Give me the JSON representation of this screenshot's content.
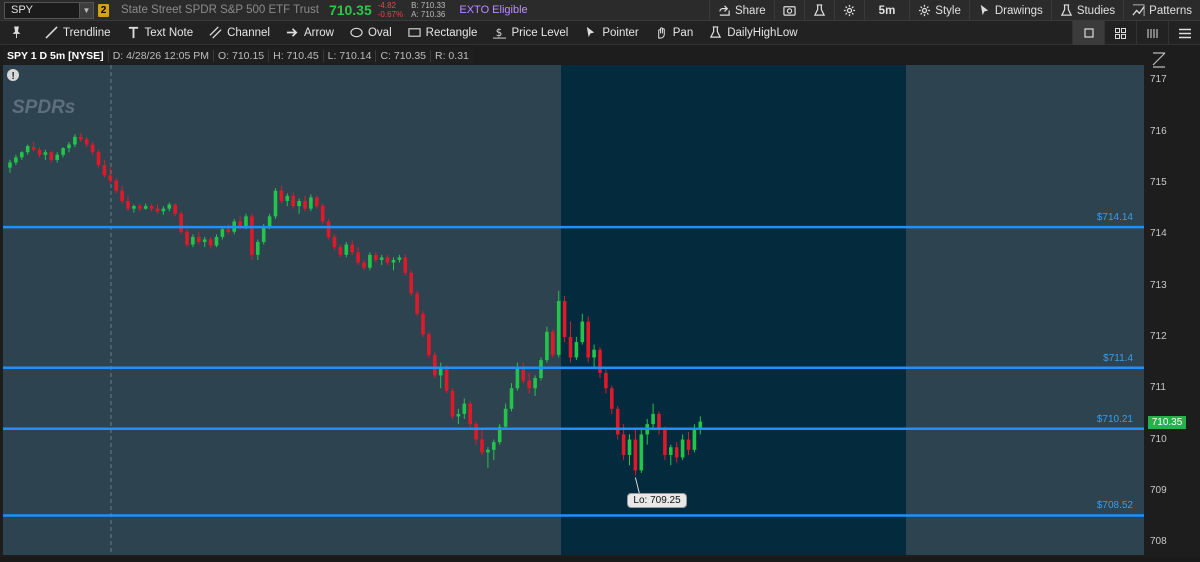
{
  "header": {
    "symbol": "SPY",
    "link_group": "2",
    "description": "State Street SPDR S&P 500 ETF Trust",
    "last": "710.35",
    "change": "-4.82",
    "change_pct": "-0.67%",
    "bid": "B: 710.33",
    "ask": "A: 710.36",
    "exto": "EXTO Eligible",
    "share_label": "Share",
    "timeframe": "5m",
    "style_label": "Style",
    "drawings_label": "Drawings",
    "studies_label": "Studies",
    "patterns_label": "Patterns"
  },
  "toolbar": {
    "trendline": "Trendline",
    "text_note": "Text Note",
    "channel": "Channel",
    "arrow": "Arrow",
    "oval": "Oval",
    "rectangle": "Rectangle",
    "price_level": "Price Level",
    "pointer": "Pointer",
    "pan": "Pan",
    "daily_high_low": "DailyHighLow"
  },
  "infobar": {
    "title": "SPY 1 D 5m [NYSE]",
    "date": "D: 4/28/26 12:05 PM",
    "open": "O: 710.15",
    "high": "H: 710.45",
    "low": "L: 710.14",
    "close": "C: 710.35",
    "range": "R: 0.31"
  },
  "chart_data": {
    "type": "candlestick",
    "yticks": [
      "717",
      "716",
      "715",
      "714",
      "713",
      "712",
      "711",
      "710",
      "709",
      "708"
    ],
    "ylim": [
      707.75,
      717.3
    ],
    "price_levels": [
      {
        "label": "$714.14",
        "value": 714.14
      },
      {
        "label": "$711.4",
        "value": 711.4
      },
      {
        "label": "$710.21",
        "value": 710.21
      },
      {
        "label": "$708.52",
        "value": 708.52
      }
    ],
    "current_price": "710.35",
    "low_annotation": "Lo: 709.25",
    "watermark": "SPDRs",
    "colors": {
      "up": "#23c44a",
      "down": "#e0192a",
      "level": "#1e90ff",
      "session_bg": "#2e4350",
      "highlight_bg": "#032a3d",
      "background": "#22343f"
    },
    "candles": [
      [
        715.3,
        715.45,
        715.2,
        715.4
      ],
      [
        715.4,
        715.55,
        715.35,
        715.5
      ],
      [
        715.5,
        715.62,
        715.45,
        715.6
      ],
      [
        715.6,
        715.75,
        715.55,
        715.72
      ],
      [
        715.7,
        715.8,
        715.62,
        715.65
      ],
      [
        715.65,
        715.7,
        715.5,
        715.55
      ],
      [
        715.55,
        715.65,
        715.45,
        715.6
      ],
      [
        715.6,
        715.62,
        715.4,
        715.45
      ],
      [
        715.45,
        715.6,
        715.4,
        715.55
      ],
      [
        715.55,
        715.7,
        715.5,
        715.68
      ],
      [
        715.68,
        715.8,
        715.6,
        715.75
      ],
      [
        715.75,
        715.95,
        715.7,
        715.9
      ],
      [
        715.9,
        715.98,
        715.8,
        715.85
      ],
      [
        715.85,
        715.9,
        715.7,
        715.75
      ],
      [
        715.75,
        715.8,
        715.55,
        715.6
      ],
      [
        715.6,
        715.65,
        715.3,
        715.35
      ],
      [
        715.35,
        715.45,
        715.1,
        715.15
      ],
      [
        715.15,
        715.3,
        715.0,
        715.05
      ],
      [
        715.05,
        715.1,
        714.8,
        714.85
      ],
      [
        714.85,
        714.95,
        714.6,
        714.65
      ],
      [
        714.65,
        714.75,
        714.45,
        714.5
      ],
      [
        714.5,
        714.58,
        714.42,
        714.55
      ],
      [
        714.55,
        714.6,
        714.45,
        714.5
      ],
      [
        714.5,
        714.6,
        714.48,
        714.55
      ],
      [
        714.55,
        714.6,
        714.45,
        714.5
      ],
      [
        714.5,
        714.58,
        714.4,
        714.45
      ],
      [
        714.45,
        714.55,
        714.38,
        714.5
      ],
      [
        714.5,
        714.62,
        714.45,
        714.58
      ],
      [
        714.58,
        714.6,
        714.35,
        714.4
      ],
      [
        714.4,
        714.45,
        714.0,
        714.05
      ],
      [
        714.05,
        714.1,
        713.75,
        713.8
      ],
      [
        713.8,
        714.0,
        713.75,
        713.95
      ],
      [
        713.95,
        714.05,
        713.8,
        713.85
      ],
      [
        713.85,
        713.95,
        713.75,
        713.9
      ],
      [
        713.9,
        713.95,
        713.72,
        713.78
      ],
      [
        713.78,
        714.0,
        713.75,
        713.95
      ],
      [
        713.95,
        714.15,
        713.9,
        714.1
      ],
      [
        714.1,
        714.2,
        714.0,
        714.05
      ],
      [
        714.05,
        714.3,
        714.0,
        714.25
      ],
      [
        714.25,
        714.35,
        714.1,
        714.15
      ],
      [
        714.15,
        714.4,
        714.1,
        714.35
      ],
      [
        714.35,
        714.4,
        713.5,
        713.6
      ],
      [
        713.6,
        713.9,
        713.5,
        713.85
      ],
      [
        713.85,
        714.2,
        713.8,
        714.15
      ],
      [
        714.15,
        714.4,
        714.1,
        714.35
      ],
      [
        714.35,
        714.9,
        714.3,
        714.85
      ],
      [
        714.85,
        714.95,
        714.6,
        714.65
      ],
      [
        714.65,
        714.8,
        714.55,
        714.75
      ],
      [
        714.75,
        714.82,
        714.5,
        714.55
      ],
      [
        714.55,
        714.7,
        714.4,
        714.65
      ],
      [
        714.65,
        714.75,
        714.45,
        714.5
      ],
      [
        714.5,
        714.78,
        714.45,
        714.72
      ],
      [
        714.72,
        714.75,
        714.5,
        714.55
      ],
      [
        714.55,
        714.6,
        714.2,
        714.25
      ],
      [
        714.25,
        714.3,
        713.9,
        713.95
      ],
      [
        713.95,
        714.0,
        713.7,
        713.75
      ],
      [
        713.75,
        713.8,
        713.55,
        713.6
      ],
      [
        713.6,
        713.85,
        713.55,
        713.8
      ],
      [
        713.8,
        713.88,
        713.6,
        713.65
      ],
      [
        713.65,
        713.75,
        713.4,
        713.45
      ],
      [
        713.45,
        713.5,
        713.3,
        713.35
      ],
      [
        713.35,
        713.65,
        713.3,
        713.6
      ],
      [
        713.6,
        713.65,
        713.45,
        713.5
      ],
      [
        713.5,
        713.6,
        713.4,
        713.55
      ],
      [
        713.55,
        713.6,
        713.4,
        713.45
      ],
      [
        713.45,
        713.55,
        713.3,
        713.5
      ],
      [
        713.5,
        713.6,
        713.45,
        713.55
      ],
      [
        713.55,
        713.6,
        713.2,
        713.25
      ],
      [
        713.25,
        713.3,
        712.8,
        712.85
      ],
      [
        712.85,
        712.9,
        712.4,
        712.45
      ],
      [
        712.45,
        712.5,
        712.0,
        712.05
      ],
      [
        712.05,
        712.1,
        711.6,
        711.65
      ],
      [
        711.65,
        711.7,
        711.2,
        711.25
      ],
      [
        711.25,
        711.5,
        711.0,
        711.4
      ],
      [
        711.4,
        711.45,
        710.9,
        710.95
      ],
      [
        710.95,
        711.0,
        710.4,
        710.45
      ],
      [
        710.45,
        710.6,
        710.3,
        710.5
      ],
      [
        710.5,
        710.8,
        710.4,
        710.7
      ],
      [
        710.7,
        710.75,
        710.2,
        710.3
      ],
      [
        710.3,
        710.35,
        709.9,
        710.0
      ],
      [
        710.0,
        710.2,
        709.7,
        709.75
      ],
      [
        709.75,
        709.85,
        709.45,
        709.8
      ],
      [
        709.8,
        710.0,
        709.6,
        709.95
      ],
      [
        709.95,
        710.3,
        709.9,
        710.25
      ],
      [
        710.25,
        710.7,
        710.2,
        710.6
      ],
      [
        710.6,
        711.1,
        710.55,
        711.0
      ],
      [
        711.0,
        711.5,
        710.95,
        711.4
      ],
      [
        711.4,
        711.5,
        711.1,
        711.15
      ],
      [
        711.15,
        711.3,
        710.9,
        711.0
      ],
      [
        711.0,
        711.25,
        710.85,
        711.2
      ],
      [
        711.2,
        711.6,
        711.15,
        711.55
      ],
      [
        711.55,
        712.2,
        711.5,
        712.1
      ],
      [
        712.1,
        712.15,
        711.6,
        711.65
      ],
      [
        711.65,
        712.9,
        711.6,
        712.7
      ],
      [
        712.7,
        712.8,
        711.9,
        712.0
      ],
      [
        712.0,
        712.3,
        711.5,
        711.6
      ],
      [
        711.6,
        712.0,
        711.55,
        711.9
      ],
      [
        711.9,
        712.45,
        711.85,
        712.3
      ],
      [
        712.3,
        712.4,
        711.5,
        711.6
      ],
      [
        711.6,
        711.85,
        711.4,
        711.75
      ],
      [
        711.75,
        711.8,
        711.2,
        711.3
      ],
      [
        711.3,
        711.4,
        710.9,
        711.0
      ],
      [
        711.0,
        711.05,
        710.5,
        710.6
      ],
      [
        710.6,
        710.65,
        710.0,
        710.1
      ],
      [
        710.1,
        710.3,
        709.6,
        709.7
      ],
      [
        709.7,
        710.1,
        709.5,
        710.0
      ],
      [
        710.0,
        710.2,
        709.3,
        709.4
      ],
      [
        709.4,
        710.2,
        709.35,
        710.1
      ],
      [
        710.1,
        710.4,
        709.9,
        710.3
      ],
      [
        710.3,
        710.7,
        710.2,
        710.5
      ],
      [
        710.5,
        710.55,
        710.1,
        710.2
      ],
      [
        710.2,
        710.25,
        709.6,
        709.7
      ],
      [
        709.7,
        709.9,
        709.5,
        709.85
      ],
      [
        709.85,
        709.95,
        709.55,
        709.65
      ],
      [
        709.65,
        710.1,
        709.6,
        710.0
      ],
      [
        710.0,
        710.15,
        709.7,
        709.8
      ],
      [
        709.8,
        710.3,
        709.75,
        710.2
      ],
      [
        710.2,
        710.45,
        710.1,
        710.35
      ]
    ]
  }
}
